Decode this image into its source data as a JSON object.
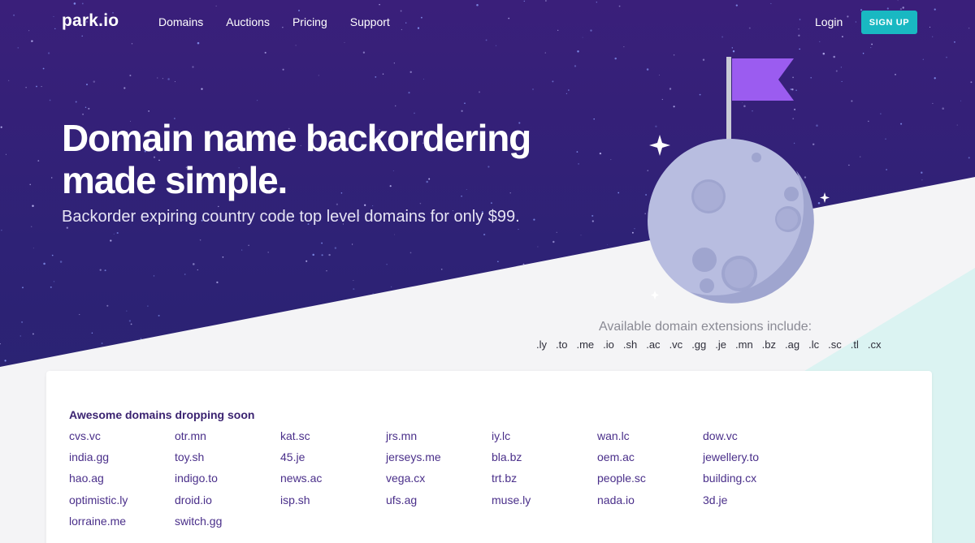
{
  "nav": {
    "logo": "park.io",
    "links": [
      "Domains",
      "Auctions",
      "Pricing",
      "Support"
    ],
    "login": "Login",
    "signup": "SIGN UP"
  },
  "hero": {
    "headline_line1": "Domain name backordering",
    "headline_line2": "made simple.",
    "subhead": "Backorder expiring country code top level domains for only $99."
  },
  "extensions": {
    "title": "Available domain extensions include:",
    "items": [
      ".ly",
      ".to",
      ".me",
      ".io",
      ".sh",
      ".ac",
      ".vc",
      ".gg",
      ".je",
      ".mn",
      ".bz",
      ".ag",
      ".lc",
      ".sc",
      ".tl",
      ".cx"
    ]
  },
  "dropping": {
    "title": "Awesome domains dropping soon",
    "columns": [
      [
        "cvs.vc",
        "india.gg",
        "hao.ag",
        "optimistic.ly",
        "lorraine.me"
      ],
      [
        "otr.mn",
        "toy.sh",
        "indigo.to",
        "droid.io",
        "switch.gg"
      ],
      [
        "kat.sc",
        "45.je",
        "news.ac",
        "isp.sh"
      ],
      [
        "jrs.mn",
        "jerseys.me",
        "vega.cx",
        "ufs.ag"
      ],
      [
        "iy.lc",
        "bla.bz",
        "trt.bz",
        "muse.ly"
      ],
      [
        "wan.lc",
        "oem.ac",
        "people.sc",
        "nada.io"
      ],
      [
        "dow.vc",
        "jewellery.to",
        "building.cx",
        "3d.je"
      ]
    ]
  },
  "colors": {
    "hero_purple": "#2e2276",
    "accent_teal": "#19b8c2",
    "flag_purple": "#9b5cf0",
    "moon": "#b8bde0",
    "domain_link": "#4a2f8a"
  }
}
